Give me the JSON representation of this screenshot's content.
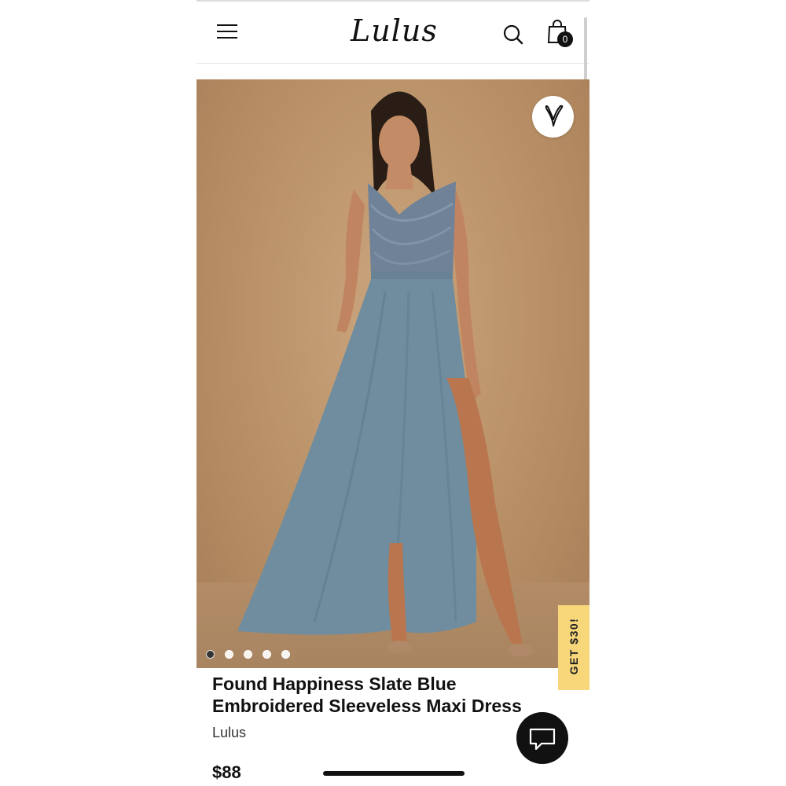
{
  "header": {
    "logo_text": "Lulus",
    "cart_count": "0"
  },
  "gallery": {
    "image_count": 5,
    "active_index": 0
  },
  "promo": {
    "label": "GET $30!"
  },
  "product": {
    "title": "Found Happiness Slate Blue Embroidered Sleeveless Maxi Dress",
    "brand": "Lulus",
    "price": "$88"
  },
  "icons": {
    "menu": "hamburger-menu-icon",
    "search": "search-icon",
    "bag": "shopping-bag-icon",
    "favorite": "heart-icon",
    "chat": "chat-bubble-icon"
  },
  "colors": {
    "promo_bg": "#f7d77a",
    "dress": "#6f8d9e",
    "backdrop": "#b99066"
  }
}
